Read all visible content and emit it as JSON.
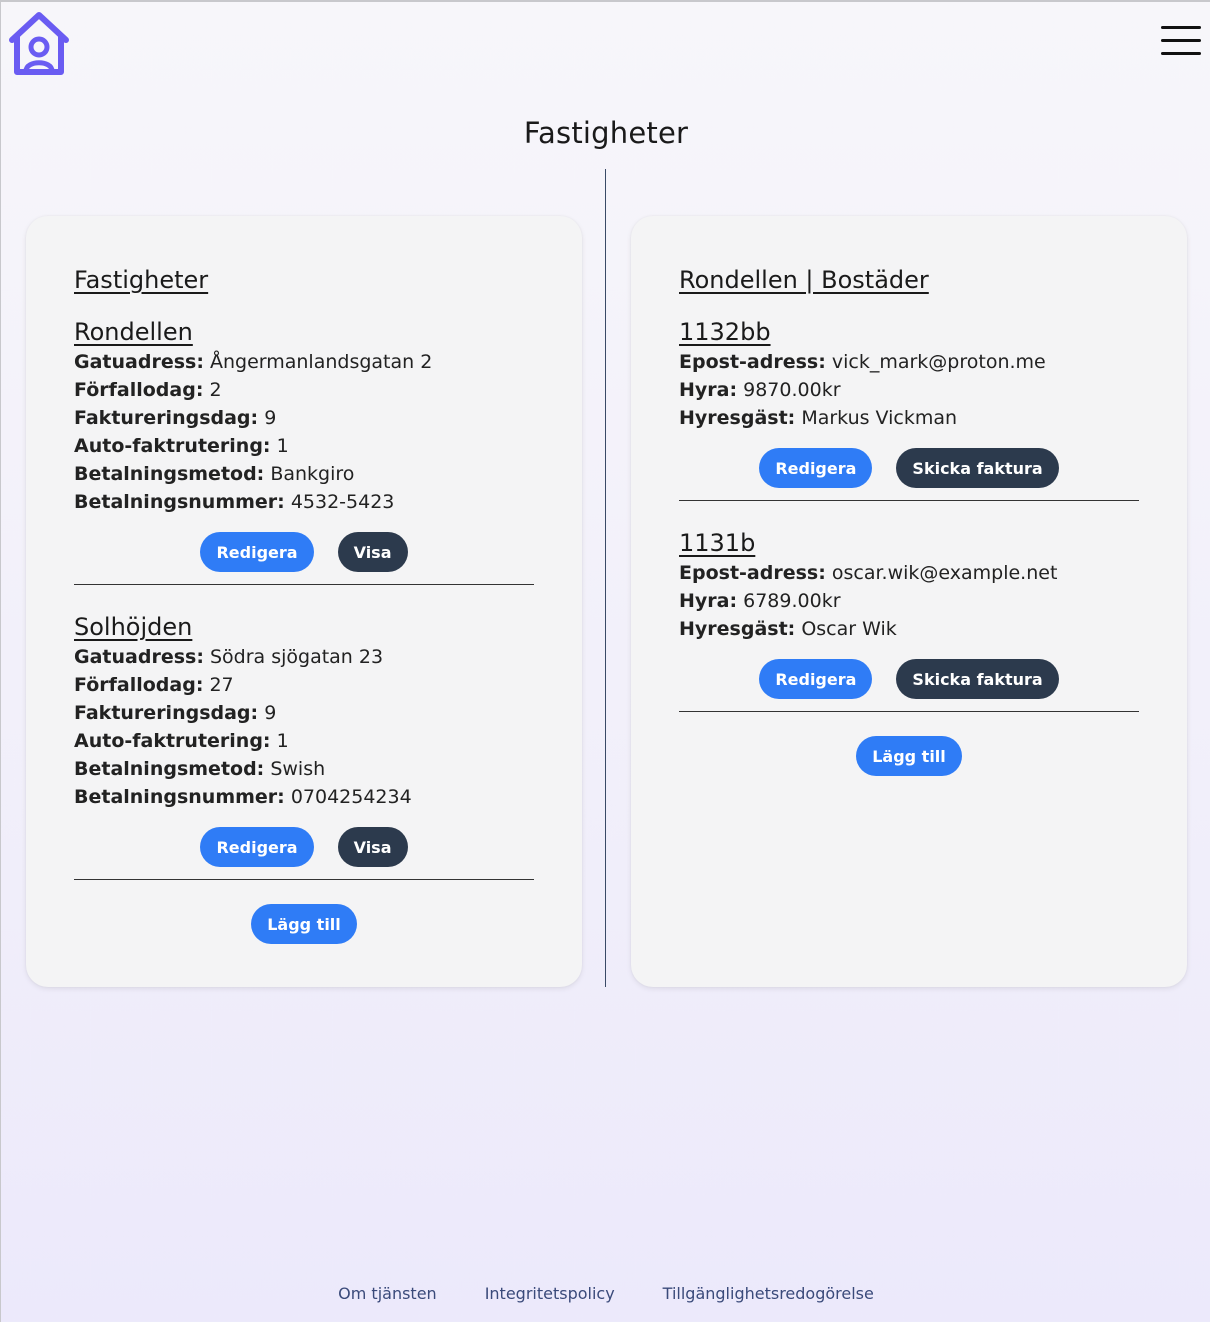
{
  "header": {
    "logo_icon": "house-user-icon",
    "menu_icon": "hamburger-menu-icon",
    "page_title": "Fastigheter"
  },
  "colors": {
    "primary_button": "#2f7cf6",
    "dark_button": "#2c3a4d",
    "logo": "#6a5cf2"
  },
  "left_card": {
    "heading": "Fastigheter",
    "labels": {
      "street": "Gatuadress:",
      "due_day": "Förfallodag:",
      "billing_day": "Faktureringsdag:",
      "auto_billing": "Auto-faktrutering:",
      "payment_method": "Betalningsmetod:",
      "payment_number": "Betalningsnummer:"
    },
    "properties": [
      {
        "name": "Rondellen",
        "street": "Ångermanlandsgatan 2",
        "due_day": "2",
        "billing_day": "9",
        "auto_billing": "1",
        "payment_method": "Bankgiro",
        "payment_number": "4532-5423",
        "edit_label": "Redigera",
        "view_label": "Visa"
      },
      {
        "name": "Solhöjden",
        "street": "Södra sjögatan 23",
        "due_day": "27",
        "billing_day": "9",
        "auto_billing": "1",
        "payment_method": "Swish",
        "payment_number": "0704254234",
        "edit_label": "Redigera",
        "view_label": "Visa"
      }
    ],
    "add_label": "Lägg till"
  },
  "right_card": {
    "heading": "Rondellen | Bostäder",
    "labels": {
      "email": "Epost-adress:",
      "rent": "Hyra:",
      "tenant": "Hyresgäst:"
    },
    "units": [
      {
        "name": "1132bb",
        "email": "vick_mark@proton.me",
        "rent": "9870.00kr",
        "tenant": "Markus Vickman",
        "edit_label": "Redigera",
        "invoice_label": "Skicka faktura"
      },
      {
        "name": "1131b",
        "email": "oscar.wik@example.net",
        "rent": "6789.00kr",
        "tenant": "Oscar Wik",
        "edit_label": "Redigera",
        "invoice_label": "Skicka faktura"
      }
    ],
    "add_label": "Lägg till"
  },
  "footer": {
    "links": [
      "Om tjänsten",
      "Integritetspolicy",
      "Tillgänglighetsredogörelse"
    ]
  }
}
